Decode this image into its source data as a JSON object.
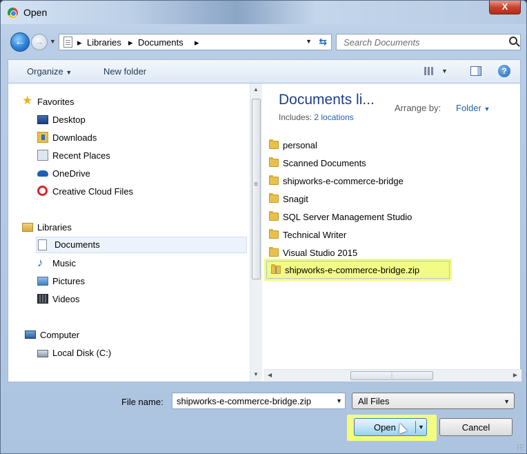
{
  "window": {
    "title": "Open",
    "close_glyph": "X"
  },
  "address": {
    "crumbs": [
      "Libraries",
      "Documents"
    ],
    "search_placeholder": "Search Documents"
  },
  "toolbar": {
    "organize": "Organize",
    "new_folder": "New folder",
    "help_glyph": "?"
  },
  "nav": {
    "favorites": "Favorites",
    "desktop": "Desktop",
    "downloads": "Downloads",
    "recent_places": "Recent Places",
    "onedrive": "OneDrive",
    "creative_cloud": "Creative Cloud Files",
    "libraries": "Libraries",
    "documents": "Documents",
    "music": "Music",
    "pictures": "Pictures",
    "videos": "Videos",
    "computer": "Computer",
    "local_disk": "Local Disk (C:)"
  },
  "library": {
    "title": "Documents li...",
    "includes_label": "Includes:",
    "includes_link": "2 locations",
    "arrange_label": "Arrange by:",
    "arrange_value": "Folder"
  },
  "files": [
    "personal",
    "Scanned Documents",
    "shipworks-e-commerce-bridge",
    "Snagit",
    "SQL Server Management Studio",
    "Technical Writer",
    "Visual Studio 2015",
    "shipworks-e-commerce-bridge.zip"
  ],
  "footer": {
    "file_name_label": "File name:",
    "file_name_value": "shipworks-e-commerce-bridge.zip",
    "file_type": "All Files",
    "open": "Open",
    "cancel": "Cancel"
  },
  "colors": {
    "highlight": "#f3fc7c",
    "link": "#1c62b4",
    "title_blue": "#1e3e8c"
  }
}
